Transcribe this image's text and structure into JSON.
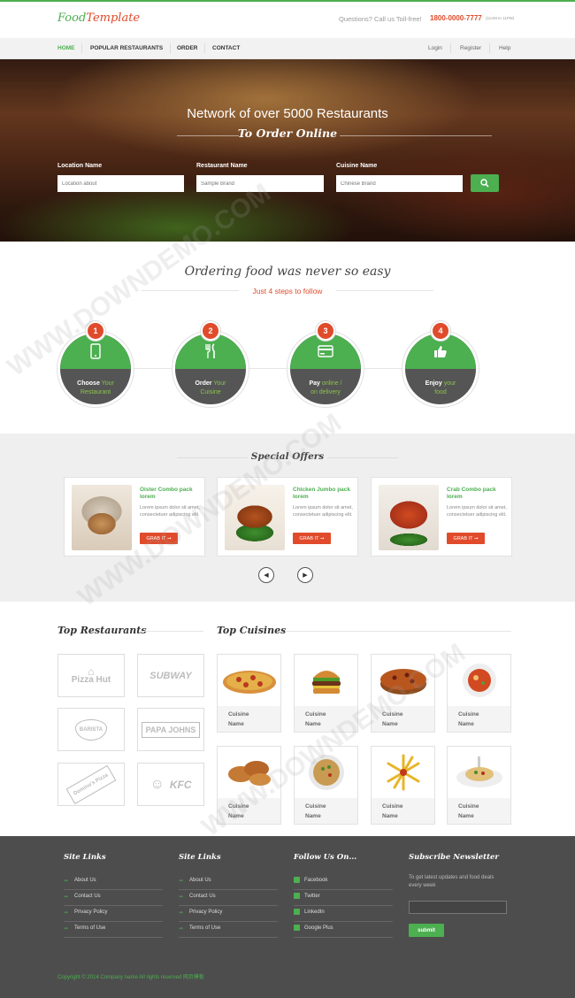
{
  "header": {
    "logo_part1": "Food",
    "logo_part2": "Template",
    "call_question": "Questions? Call us Toll-free!",
    "call_number": "1800-0000-7777",
    "call_hours": "(11AM to 11PM)"
  },
  "nav": {
    "items": [
      "HOME",
      "POPULAR RESTAURANTS",
      "ORDER",
      "CONTACT"
    ],
    "right": [
      "Login",
      "Register",
      "Help"
    ]
  },
  "hero": {
    "title": "Network of over 5000 Restaurants",
    "subtitle": "To Order Online",
    "fields": [
      {
        "label": "Location Name",
        "placeholder": "Location about"
      },
      {
        "label": "Restaurant Name",
        "placeholder": "Sample Brand"
      },
      {
        "label": "Cuisine Name",
        "placeholder": "Chinese Brand"
      }
    ]
  },
  "steps": {
    "title": "Ordering food was never so easy",
    "subtitle": "Just 4 steps to follow",
    "items": [
      {
        "num": "1",
        "bold": "Choose",
        "rest": "Your",
        "line2": "Restaurant",
        "icon": "mobile-icon"
      },
      {
        "num": "2",
        "bold": "Order",
        "rest": "Your",
        "line2": "Cuisine",
        "icon": "fork-knife-icon"
      },
      {
        "num": "3",
        "bold": "Pay",
        "rest": "online /",
        "line2": "on delivery",
        "icon": "credit-card-icon"
      },
      {
        "num": "4",
        "bold": "Enjoy",
        "rest": "your",
        "line2": "food",
        "icon": "thumbs-up-icon"
      }
    ]
  },
  "offers": {
    "title": "Special Offers",
    "items": [
      {
        "title": "Oister Combo pack lorem",
        "desc": "Lorem ipsum dolor sit amet, consectetuer adipiscing elit.",
        "button": "GRAB IT"
      },
      {
        "title": "Chicken Jumbo pack lorem",
        "desc": "Lorem ipsum dolor sit amet, consectetuer adipiscing elit.",
        "button": "GRAB IT"
      },
      {
        "title": "Crab Combo pack lorem",
        "desc": "Lorem ipsum dolor sit amet, consectetuer adipiscing elit.",
        "button": "GRAB IT"
      }
    ]
  },
  "restaurants": {
    "title": "Top Restaurants",
    "logos": [
      "Pizza Hut",
      "SUBWAY",
      "BARISTA",
      "PAPA JOHNS",
      "Domino's Pizza",
      "KFC"
    ]
  },
  "cuisines": {
    "title": "Top Cuisines",
    "items": [
      {
        "l1": "Cuisine",
        "l2": "Name"
      },
      {
        "l1": "Cuisine",
        "l2": "Name"
      },
      {
        "l1": "Cuisine",
        "l2": "Name"
      },
      {
        "l1": "Cuisine",
        "l2": "Name"
      },
      {
        "l1": "Cuisine",
        "l2": "Name"
      },
      {
        "l1": "Cuisine",
        "l2": "Name"
      },
      {
        "l1": "Cuisine",
        "l2": "Name"
      },
      {
        "l1": "Cuisine",
        "l2": "Name"
      }
    ]
  },
  "footer": {
    "col1_title": "Site Links",
    "col2_title": "Site Links",
    "col3_title": "Follow Us On...",
    "col4_title": "Subscribe Newsletter",
    "links": [
      "About Us",
      "Contact Us",
      "Privacy Policy",
      "Terms of Use"
    ],
    "social": [
      "Facebook",
      "Twitter",
      "LinkedIn",
      "Google Plus"
    ],
    "newsletter_desc": "To get latest updates and food deals every week",
    "submit": "submit",
    "copyright": "Copyright © 2014 Company name All rights reserved 网页模板"
  },
  "watermark": "WWW.DOWNDEMO.COM",
  "colors": {
    "accent": "#4caf50",
    "brand_red": "#e04b2b",
    "footer_bg": "#4d4d4d"
  }
}
